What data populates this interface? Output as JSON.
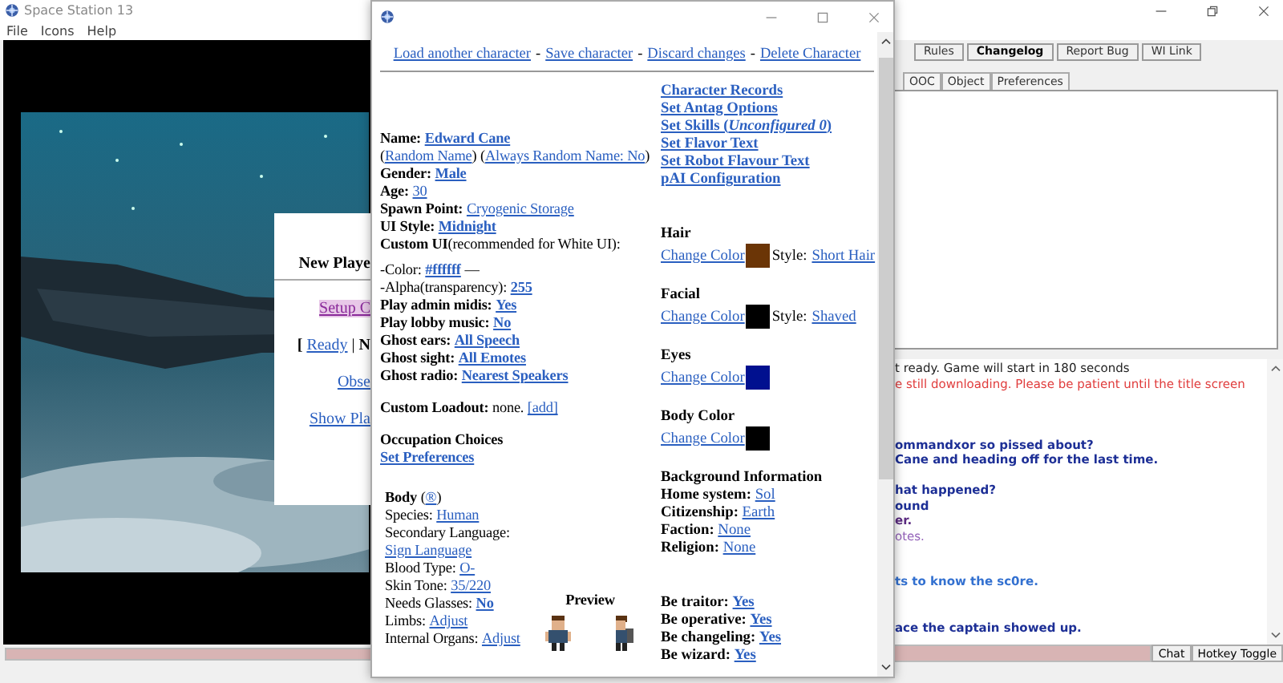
{
  "main_window": {
    "title": "Space Station 13",
    "menu": [
      "File",
      "Icons",
      "Help"
    ],
    "lobby_panel": {
      "title": "New Playe",
      "setup_link": "Setup C",
      "ready_open": "[",
      "ready_link": "Ready",
      "ready_separator": "|",
      "ready_next": "N",
      "observe_link": "Obse",
      "show_players_link": "Show Pla"
    },
    "top_buttons": [
      {
        "label": "Rules",
        "highlighted": false
      },
      {
        "label": "Changelog",
        "highlighted": true
      },
      {
        "label": "Report Bug",
        "highlighted": false
      },
      {
        "label": "WI Link",
        "highlighted": false
      }
    ],
    "stat_tabs": [
      "OOC",
      "Object",
      "Preferences"
    ],
    "chat_lines": [
      {
        "kind": "system",
        "text": "t ready. Game will start in 180 seconds"
      },
      {
        "kind": "warning",
        "text": "e still downloading. Please be patient until the title screen"
      },
      {
        "kind": "blank"
      },
      {
        "kind": "blank"
      },
      {
        "kind": "blank"
      },
      {
        "kind": "say",
        "text": "ommandxor so pissed about?"
      },
      {
        "kind": "say",
        "text": "Cane and heading off for the last time."
      },
      {
        "kind": "blank"
      },
      {
        "kind": "say",
        "text": "hat happened?"
      },
      {
        "kind": "say",
        "text": "ound"
      },
      {
        "kind": "dead",
        "text": "er."
      },
      {
        "kind": "emote",
        "text": "otes."
      },
      {
        "kind": "blank"
      },
      {
        "kind": "blank"
      },
      {
        "kind": "ooc",
        "text": "ts to know the sc0re."
      },
      {
        "kind": "blank"
      },
      {
        "kind": "blank"
      },
      {
        "kind": "say",
        "text": "ace the captain showed up."
      }
    ],
    "chat_buttons": [
      "Chat",
      "Hotkey Toggle"
    ]
  },
  "dialog": {
    "header_links": [
      "Load another character",
      "Save character",
      "Discard changes",
      "Delete Character"
    ],
    "header_separator": "-",
    "left_groups": [
      [
        {
          "segments": [
            {
              "kind": "label",
              "text": "Name:"
            },
            {
              "kind": "strong-link",
              "text": "Edward Cane"
            }
          ]
        },
        {
          "segments": [
            {
              "kind": "open",
              "text": "("
            },
            {
              "kind": "link",
              "text": "Random Name"
            },
            {
              "kind": "close",
              "text": ")"
            },
            {
              "kind": "open",
              "text": "("
            },
            {
              "kind": "link",
              "text": "Always Random Name: No"
            },
            {
              "kind": "close",
              "text": ")"
            }
          ]
        },
        {
          "segments": [
            {
              "kind": "label",
              "text": "Gender:"
            },
            {
              "kind": "strong-link",
              "text": "Male"
            }
          ]
        },
        {
          "segments": [
            {
              "kind": "label",
              "text": "Age:"
            },
            {
              "kind": "link",
              "text": "30"
            }
          ]
        },
        {
          "segments": [
            {
              "kind": "label",
              "text": "Spawn Point:"
            },
            {
              "kind": "link",
              "text": "Cryogenic Storage"
            }
          ]
        },
        {
          "segments": [
            {
              "kind": "label",
              "text": "UI Style:"
            },
            {
              "kind": "strong-link",
              "text": "Midnight"
            }
          ]
        },
        {
          "segments": [
            {
              "kind": "label",
              "text": "Custom UI"
            },
            {
              "kind": "note",
              "text": "(recommended for White UI):"
            }
          ]
        }
      ],
      [
        {
          "segments": [
            {
              "kind": "text",
              "text": "-Color:"
            },
            {
              "kind": "strong-link",
              "text": "#ffffff"
            },
            {
              "kind": "text",
              "text": "—"
            }
          ]
        },
        {
          "segments": [
            {
              "kind": "text",
              "text": "-Alpha(transparency):"
            },
            {
              "kind": "strong-link",
              "text": "255"
            }
          ]
        },
        {
          "segments": [
            {
              "kind": "label",
              "text": "Play admin midis:"
            },
            {
              "kind": "strong-link",
              "text": "Yes"
            }
          ]
        },
        {
          "segments": [
            {
              "kind": "label",
              "text": "Play lobby music:"
            },
            {
              "kind": "strong-link",
              "text": "No"
            }
          ]
        },
        {
          "segments": [
            {
              "kind": "label",
              "text": "Ghost ears:"
            },
            {
              "kind": "strong-link",
              "text": "All Speech"
            }
          ]
        },
        {
          "segments": [
            {
              "kind": "label",
              "text": "Ghost sight:"
            },
            {
              "kind": "strong-link",
              "text": "All Emotes"
            }
          ]
        },
        {
          "segments": [
            {
              "kind": "label",
              "text": "Ghost radio:"
            },
            {
              "kind": "strong-link",
              "text": "Nearest Speakers"
            }
          ]
        }
      ],
      [
        {
          "segments": [
            {
              "kind": "label",
              "text": "Custom Loadout:"
            },
            {
              "kind": "text",
              "text": "none."
            },
            {
              "kind": "link",
              "text": "[add]"
            }
          ]
        }
      ],
      [
        {
          "segments": [
            {
              "kind": "label",
              "text": "Occupation Choices"
            }
          ]
        },
        {
          "segments": [
            {
              "kind": "strong-link",
              "text": "Set Preferences"
            }
          ]
        }
      ]
    ],
    "body_rows": [
      {
        "segments": [
          {
            "kind": "label",
            "text": "Body"
          },
          {
            "kind": "open",
            "text": "("
          },
          {
            "kind": "link",
            "text": "®"
          },
          {
            "kind": "close",
            "text": ")"
          }
        ]
      },
      {
        "segments": [
          {
            "kind": "text",
            "text": "Species:"
          },
          {
            "kind": "link",
            "text": "Human"
          }
        ]
      },
      {
        "segments": [
          {
            "kind": "text",
            "text": "Secondary Language:"
          }
        ]
      },
      {
        "segments": [
          {
            "kind": "link",
            "text": "Sign Language"
          }
        ]
      },
      {
        "segments": [
          {
            "kind": "text",
            "text": "Blood Type:"
          },
          {
            "kind": "link",
            "text": "O-"
          }
        ]
      },
      {
        "segments": [
          {
            "kind": "text",
            "text": "Skin Tone:"
          },
          {
            "kind": "link",
            "text": "35/220"
          }
        ]
      },
      {
        "segments": [
          {
            "kind": "text",
            "text": "Needs Glasses:"
          },
          {
            "kind": "strong-link",
            "text": "No"
          }
        ]
      },
      {
        "segments": [
          {
            "kind": "text",
            "text": "Limbs:"
          },
          {
            "kind": "link",
            "text": "Adjust"
          }
        ]
      },
      {
        "segments": [
          {
            "kind": "text",
            "text": "Internal Organs:"
          },
          {
            "kind": "link",
            "text": "Adjust"
          }
        ]
      }
    ],
    "preview_label": "Preview",
    "right_links": [
      "Character Records",
      "Set Antag Options",
      "Set Skills (*Unconfigured 0*)",
      "Set Flavor Text",
      "Set Robot Flavour Text",
      "pAI Configuration"
    ],
    "appearance": [
      {
        "title": "Hair",
        "link": "Change Color",
        "color": "#6b3506",
        "style_label": "Style:",
        "style": "Short Hair"
      },
      {
        "title": "Facial",
        "link": "Change Color",
        "color": "#000000",
        "style_label": "Style:",
        "style": "Shaved"
      },
      {
        "title": "Eyes",
        "link": "Change Color",
        "color": "#00108f"
      },
      {
        "title": "Body Color",
        "link": "Change Color",
        "color": "#000000"
      }
    ],
    "background": {
      "title": "Background Information",
      "rows": [
        {
          "label": "Home system:",
          "value": "Sol"
        },
        {
          "label": "Citizenship:",
          "value": "Earth"
        },
        {
          "label": "Faction:",
          "value": "None"
        },
        {
          "label": "Religion:",
          "value": "None"
        }
      ]
    },
    "antag_rows": [
      {
        "label": "Be traitor:",
        "value": "Yes"
      },
      {
        "label": "Be operative:",
        "value": "Yes"
      },
      {
        "label": "Be changeling:",
        "value": "Yes"
      },
      {
        "label": "Be wizard:",
        "value": "Yes"
      }
    ]
  }
}
